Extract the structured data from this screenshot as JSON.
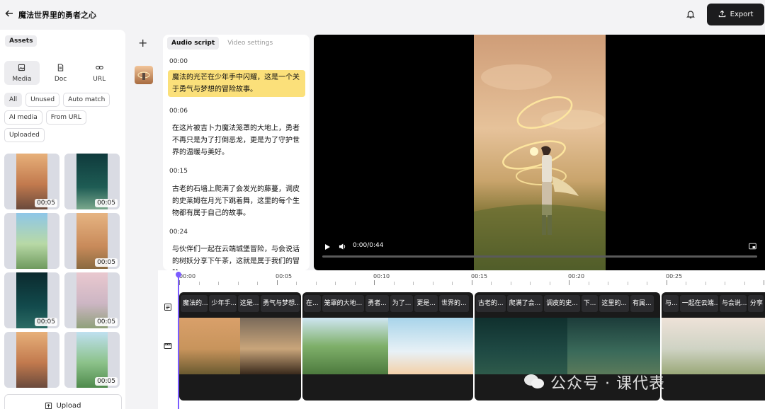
{
  "header": {
    "title": "魔法世界里的勇者之心",
    "export_label": "Export"
  },
  "assets": {
    "tab_label": "Assets",
    "source_tabs": [
      {
        "label": "Media",
        "icon": "image-icon"
      },
      {
        "label": "Doc",
        "icon": "doc-icon"
      },
      {
        "label": "URL",
        "icon": "link-icon"
      }
    ],
    "filters": [
      "All",
      "Unused",
      "Auto match",
      "AI media",
      "From URL",
      "Uploaded"
    ],
    "thumbnails": [
      {
        "duration": "00:05"
      },
      {
        "duration": "00:05"
      },
      {
        "duration": ""
      },
      {
        "duration": "00:05"
      },
      {
        "duration": "00:05"
      },
      {
        "duration": "00:05"
      },
      {
        "duration": ""
      },
      {
        "duration": "00:05"
      }
    ],
    "upload_label": "Upload"
  },
  "script": {
    "tabs": [
      "Audio script",
      "Video settings"
    ],
    "segments": [
      {
        "time": "00:00",
        "text": "魔法的光芒在少年手中闪耀，这是一个关于勇气与梦想的冒险故事。"
      },
      {
        "time": "00:06",
        "text": "在这片被吉卜力魔法笼罩的大地上，勇者不再只是为了打倒恶龙，更是为了守护世界的温暖与美好。"
      },
      {
        "time": "00:15",
        "text": "古老的石墙上爬满了会发光的藤蔓，调皮的史莱姆在月光下跳着舞，这里的每个生物都有属于自己的故事。"
      },
      {
        "time": "00:24",
        "text": "与伙伴们一起在云端城堡冒险，与会说话的树妖分享下午茶，这就是属于我们的冒险"
      }
    ]
  },
  "player": {
    "time": "0:00/0:44",
    "progress": 0
  },
  "timeline": {
    "ruler": [
      "00:00",
      "00:05",
      "00:10",
      "00:15",
      "00:20",
      "00:25"
    ],
    "clips": [
      {
        "subs": [
          "魔法的...",
          "少年手...",
          "这是...",
          "勇气与梦想..."
        ]
      },
      {
        "subs": [
          "在...",
          "笼罩的大地...",
          "勇者...",
          "为了...",
          "更是...",
          "世界的..."
        ]
      },
      {
        "subs": [
          "古老的...",
          "爬满了会...",
          "调皮的史...",
          "下...",
          "这里的...",
          "有属..."
        ]
      },
      {
        "subs": [
          "与...",
          "一起在云端...",
          "与会说...",
          "分享"
        ]
      }
    ]
  },
  "watermark": {
    "text": "公众号 · 课代表"
  }
}
